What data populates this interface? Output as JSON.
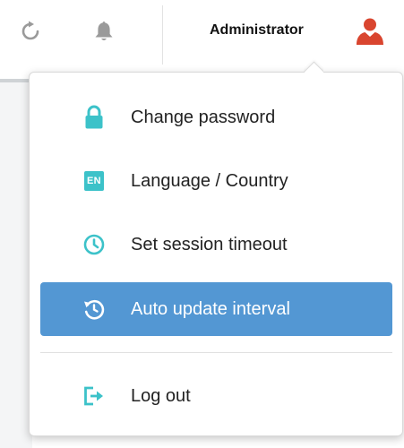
{
  "topbar": {
    "refresh_icon": "refresh-icon",
    "bell_icon": "bell-icon",
    "username": "Administrator",
    "user_icon": "user-icon"
  },
  "colors": {
    "accent": "#3cc2c9",
    "selected_background": "#5397d3",
    "user_icon": "#d9452f",
    "topbar_icon": "#999999"
  },
  "menu": {
    "items": [
      {
        "label": "Change password",
        "icon": "lock-icon"
      },
      {
        "label": "Language / Country",
        "icon": "en-badge-icon",
        "badge": "EN"
      },
      {
        "label": "Set session timeout",
        "icon": "clock-icon"
      },
      {
        "label": "Auto update interval",
        "icon": "history-icon",
        "selected": true
      },
      {
        "label": "Log out",
        "icon": "logout-icon"
      }
    ]
  }
}
